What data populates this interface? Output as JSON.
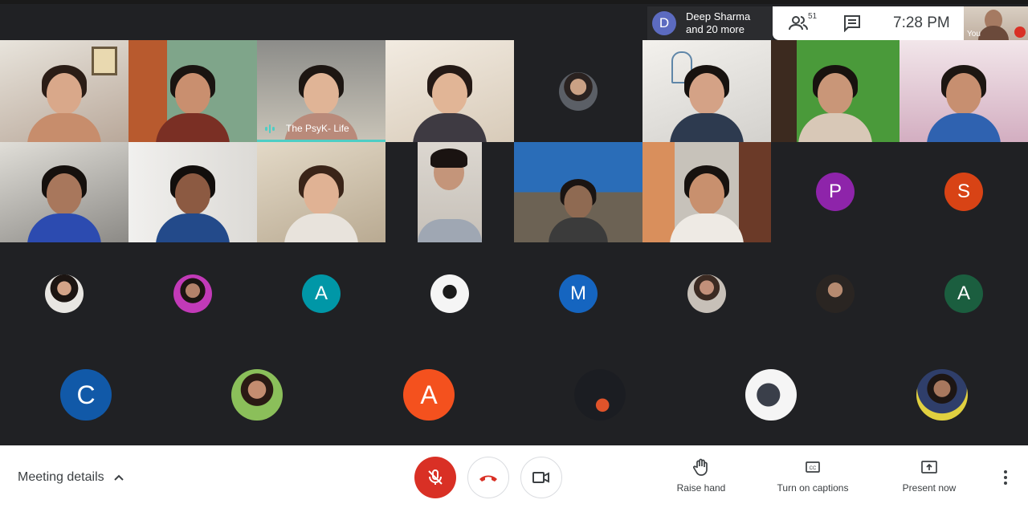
{
  "topbar": {
    "presenter_initial": "D",
    "presenter_name": "Deep Sharma",
    "presenter_more": "and 20 more",
    "people_count": "51",
    "time": "7:28  PM",
    "self_label": "You"
  },
  "grid": {
    "speaker_name": "The PsyK- Life",
    "initials": {
      "p": "P",
      "s": "S",
      "a1": "A",
      "m": "M",
      "a2": "A",
      "c": "C",
      "a3": "A"
    }
  },
  "bottom": {
    "meeting_details": "Meeting details",
    "raise_hand": "Raise hand",
    "captions": "Turn on captions",
    "present": "Present now"
  },
  "colors": {
    "end_call": "#d93025",
    "speaking": "#4ecdc4",
    "p_avatar": "#8e24aa",
    "s_avatar": "#d84315",
    "a1_avatar": "#0097a7",
    "m_avatar": "#1565c0",
    "a2_avatar": "#1b5e3f",
    "c_avatar": "#1159a8",
    "a3_avatar": "#f4511e"
  }
}
